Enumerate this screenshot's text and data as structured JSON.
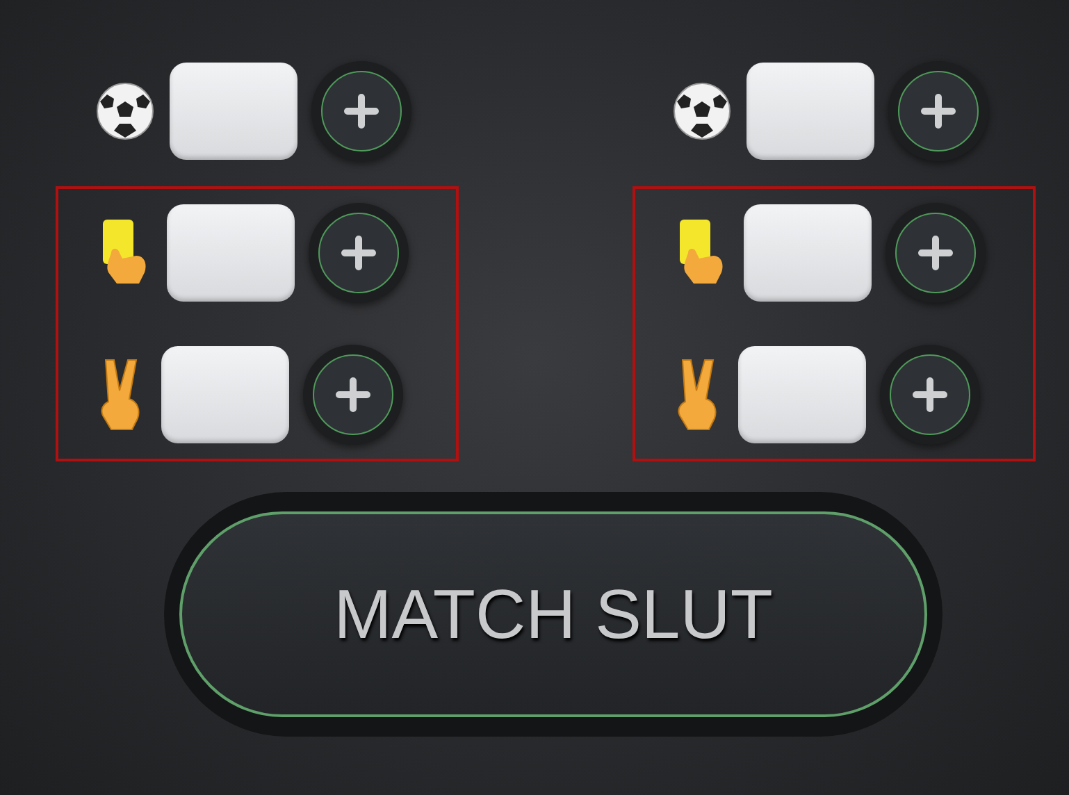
{
  "teams": [
    {
      "rows": [
        {
          "kind": "goal",
          "highlighted": false
        },
        {
          "kind": "card",
          "highlighted": true
        },
        {
          "kind": "assist",
          "highlighted": true
        }
      ]
    },
    {
      "rows": [
        {
          "kind": "goal",
          "highlighted": false
        },
        {
          "kind": "card",
          "highlighted": true
        },
        {
          "kind": "assist",
          "highlighted": true
        }
      ]
    }
  ],
  "end_button": {
    "label": "MATCH SLUT"
  }
}
